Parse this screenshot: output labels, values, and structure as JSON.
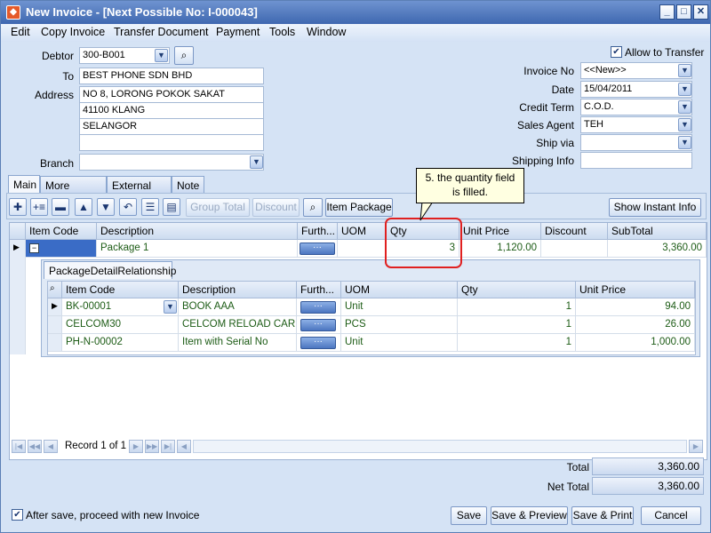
{
  "window": {
    "title": "New Invoice - [Next Possible No: I-000043]"
  },
  "menu": [
    "Edit",
    "Copy Invoice",
    "Transfer Document",
    "Payment",
    "Tools",
    "Window"
  ],
  "header": {
    "debtor_label": "Debtor",
    "debtor_value": "300-B001",
    "to_label": "To",
    "to_value": "BEST PHONE SDN BHD",
    "address_label": "Address",
    "address_lines": [
      "NO 8, LORONG POKOK SAKAT",
      "41100 KLANG",
      "SELANGOR",
      ""
    ],
    "branch_label": "Branch",
    "branch_value": "",
    "allow_transfer_label": "Allow to Transfer",
    "invoice_no_label": "Invoice No",
    "invoice_no_value": "<<New>>",
    "date_label": "Date",
    "date_value": "15/04/2011",
    "credit_term_label": "Credit Term",
    "credit_term_value": "C.O.D.",
    "sales_agent_label": "Sales Agent",
    "sales_agent_value": "TEH",
    "ship_via_label": "Ship via",
    "ship_via_value": "",
    "shipping_info_label": "Shipping Info",
    "shipping_info_value": ""
  },
  "tabs": [
    "Main",
    "More Header",
    "External Link",
    "Note"
  ],
  "toolbar": {
    "group_total": "Group Total",
    "discount": "Discount",
    "item_package": "Item Package",
    "show_instant_info": "Show Instant Info"
  },
  "grid": {
    "columns": [
      "Item Code",
      "Description",
      "Furth...",
      "UOM",
      "Qty",
      "Unit Price",
      "Discount",
      "SubTotal"
    ],
    "row": {
      "expander": "−",
      "item_code": "",
      "description": "Package 1",
      "further": "···",
      "uom": "",
      "qty": "3",
      "unit_price": "1,120.00",
      "discount": "",
      "subtotal": "3,360.00"
    }
  },
  "detail": {
    "tab": "PackageDetailRelationship",
    "columns": [
      "Item Code",
      "Description",
      "Furth...",
      "UOM",
      "Qty",
      "Unit Price"
    ],
    "rows": [
      {
        "item_code": "BK-00001",
        "description": "BOOK AAA",
        "further": "···",
        "uom": "Unit",
        "qty": "1",
        "unit_price": "94.00"
      },
      {
        "item_code": "CELCOM30",
        "description": "CELCOM RELOAD CAR...",
        "further": "···",
        "uom": "PCS",
        "qty": "1",
        "unit_price": "26.00"
      },
      {
        "item_code": "PH-N-00002",
        "description": "Item with Serial No",
        "further": "···",
        "uom": "Unit",
        "qty": "1",
        "unit_price": "1,000.00"
      }
    ]
  },
  "navigator": {
    "record_text": "Record 1 of 1"
  },
  "callout": {
    "text": "5. the quantity field is filled."
  },
  "totals": {
    "total_label": "Total",
    "total_value": "3,360.00",
    "net_total_label": "Net Total",
    "net_total_value": "3,360.00"
  },
  "footer": {
    "after_save_label": "After save, proceed with new Invoice",
    "save": "Save",
    "save_preview": "Save & Preview",
    "save_print": "Save & Print",
    "cancel": "Cancel"
  }
}
